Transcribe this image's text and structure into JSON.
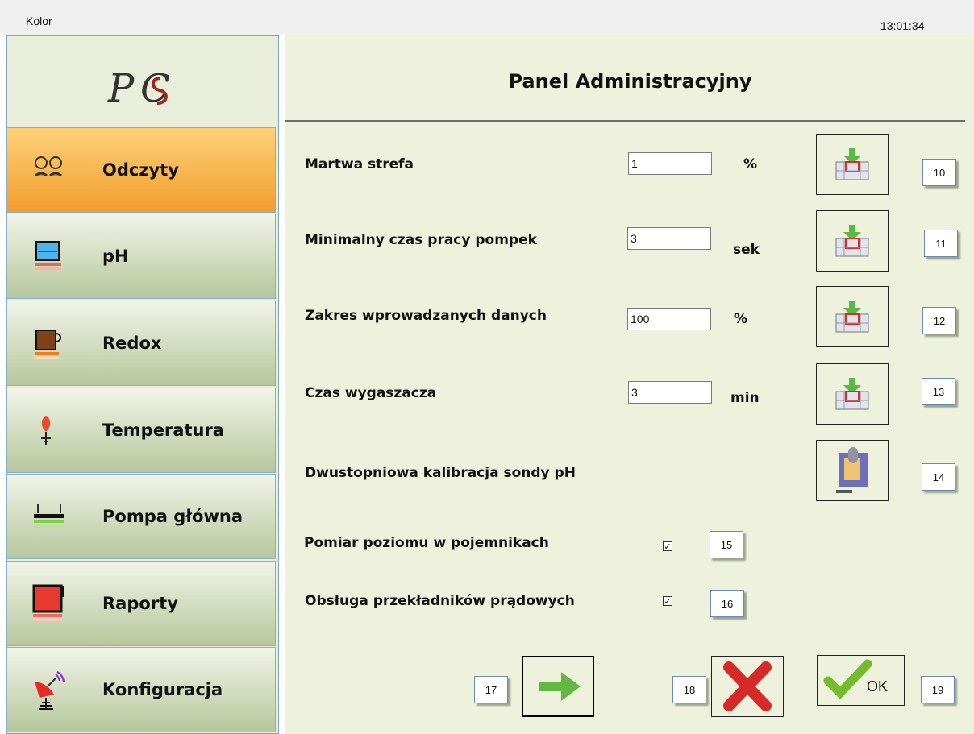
{
  "window": {
    "title": "Kolor",
    "clock": "13:01:34"
  },
  "sidebar": {
    "logo_text": "PCS",
    "items": [
      {
        "label": "Odczyty",
        "icon": "glasses-icon"
      },
      {
        "label": "pH",
        "icon": "beaker-icon"
      },
      {
        "label": "Redox",
        "icon": "mug-icon"
      },
      {
        "label": "Temperatura",
        "icon": "thermometer-icon"
      },
      {
        "label": "Pompa główna",
        "icon": "pump-icon"
      },
      {
        "label": "Raporty",
        "icon": "report-icon"
      },
      {
        "label": "Konfiguracja",
        "icon": "satellite-icon"
      }
    ],
    "active": "Odczyty"
  },
  "main": {
    "title": "Panel Administracyjny",
    "settings": [
      {
        "label": "Martwa strefa",
        "value": "1",
        "unit": "%",
        "marker": "10"
      },
      {
        "label": "Minimalny czas pracy pompek",
        "value": "3",
        "unit": "sek",
        "marker": "11"
      },
      {
        "label": "Zakres wprowadzanych danych",
        "value": "100",
        "unit": "%",
        "marker": "12"
      },
      {
        "label": "Czas wygaszacza",
        "value": "3",
        "unit": "min",
        "marker": "13"
      }
    ],
    "calibration": {
      "label": "Dwustopniowa kalibracja sondy pH",
      "marker": "14"
    },
    "checkboxes": [
      {
        "label": "Pomiar poziomu w pojemnikach",
        "checked": true,
        "marker": "15"
      },
      {
        "label": "Obsługa przekładników prądowych",
        "checked": true,
        "marker": "16"
      }
    ],
    "bottom": {
      "next_marker": "17",
      "cancel_marker": "18",
      "ok_label": "OK",
      "ok_marker": "19"
    }
  },
  "colors": {
    "active_nav": "#f29d2c",
    "nav": "#b7c79c",
    "background": "#eef2dc"
  }
}
